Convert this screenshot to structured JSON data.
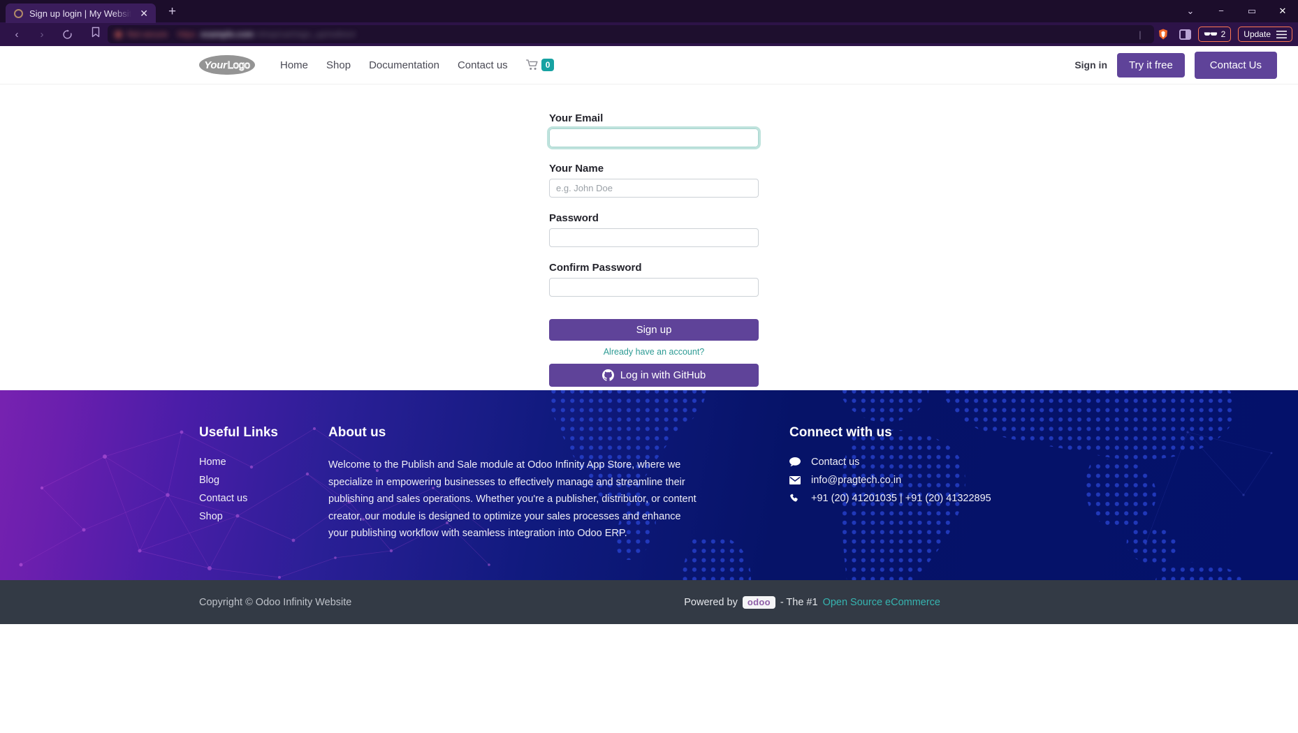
{
  "browser": {
    "tab": {
      "title": "Sign up login | My Website",
      "favicon": "circle-favicon",
      "close": "✕"
    },
    "new_tab": "+",
    "window_controls": {
      "chevron": "⌄",
      "minimize": "−",
      "maximize": "▭",
      "close": "✕"
    },
    "nav": {
      "back": "‹",
      "forward": "›",
      "reload": "reload-icon",
      "bookmark": "bookmark-icon"
    },
    "url": {
      "redacted": true,
      "seg_a": "Not secure",
      "seg_b": "https",
      "seg_c": "example.com",
      "seg_d": "/shop/cart/sign_up/redirect",
      "divider": "|"
    },
    "shields_count": "2",
    "update_label": "Update"
  },
  "site_header": {
    "logo": {
      "part1": "Your",
      "part2": "Logo"
    },
    "nav": [
      {
        "label": "Home"
      },
      {
        "label": "Shop"
      },
      {
        "label": "Documentation"
      },
      {
        "label": "Contact us"
      }
    ],
    "cart": {
      "icon": "shopping-cart-icon",
      "count": "0"
    },
    "sign_in": "Sign in",
    "try_free": "Try it free",
    "contact_us": "Contact Us"
  },
  "form": {
    "email": {
      "label": "Your Email",
      "value": "",
      "placeholder": ""
    },
    "name": {
      "label": "Your Name",
      "value": "",
      "placeholder": "e.g. John Doe"
    },
    "password": {
      "label": "Password",
      "value": "",
      "placeholder": ""
    },
    "confirm_password": {
      "label": "Confirm Password",
      "value": "",
      "placeholder": ""
    },
    "submit": "Sign up",
    "already_account": "Already have an account?",
    "github": "Log in with GitHub"
  },
  "footer": {
    "useful_links": {
      "heading": "Useful Links",
      "items": [
        {
          "label": "Home"
        },
        {
          "label": "Blog"
        },
        {
          "label": "Contact us"
        },
        {
          "label": "Shop"
        }
      ]
    },
    "about": {
      "heading": "About us",
      "text": "Welcome to the Publish and Sale module at Odoo Infinity App Store, where we specialize in empowering businesses to effectively manage and streamline their publishing and sales operations. Whether you're a publisher, distributor, or content creator, our module is designed to optimize your sales processes and enhance your publishing workflow with seamless integration into Odoo ERP."
    },
    "connect": {
      "heading": "Connect with us",
      "items": [
        {
          "icon": "comment-icon",
          "label": "Contact us"
        },
        {
          "icon": "envelope-icon",
          "label": "info@pragtech.co.in"
        },
        {
          "icon": "phone-icon",
          "label": "+91 (20) 41201035 | +91 (20) 41322895"
        }
      ]
    }
  },
  "copyright": {
    "text": "Copyright © Odoo Infinity Website",
    "powered_by": "Powered by",
    "odoo": "odoo",
    "tagline": "- The #1",
    "link": "Open Source eCommerce"
  },
  "colors": {
    "purple": "#5f4399",
    "teal": "#17a2a2",
    "footer_navy": "#04116a",
    "copy_bg": "#333a45"
  }
}
